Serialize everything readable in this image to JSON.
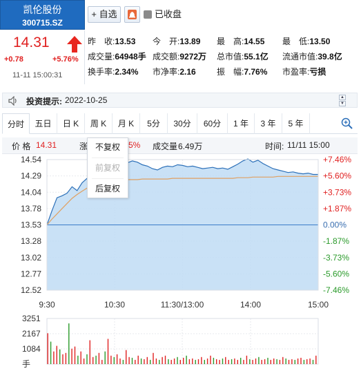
{
  "header": {
    "stock_name": "凯伦股份",
    "stock_code": "300715.SZ",
    "add_watch_label": "+ 自选",
    "market_status": "已收盘"
  },
  "quote": {
    "price": "14.31",
    "change_abs": "+0.78",
    "change_pct": "+5.76%",
    "time": "11-11 15:00:31"
  },
  "stats": [
    {
      "label": "昨　收:",
      "value": "13.53"
    },
    {
      "label": "今　开:",
      "value": "13.89"
    },
    {
      "label": "最　高:",
      "value": "14.55"
    },
    {
      "label": "最　低:",
      "value": "13.50"
    },
    {
      "label": "成交量:",
      "value": "64948手"
    },
    {
      "label": "成交额:",
      "value": "9272万"
    },
    {
      "label": "总市值:",
      "value": "55.1亿"
    },
    {
      "label": "流通市值:",
      "value": "39.8亿"
    },
    {
      "label": "换手率:",
      "value": "2.34%"
    },
    {
      "label": "市净率:",
      "value": "2.16"
    },
    {
      "label": "振　幅:",
      "value": "7.76%"
    },
    {
      "label": "市盈率:",
      "value": "亏损"
    }
  ],
  "notice": {
    "label": "投资提示:",
    "date": "2022-10-25"
  },
  "tabs": [
    "分时",
    "五日",
    "日 K",
    "周 K",
    "月 K",
    "5分",
    "30分",
    "60分",
    "1 年",
    "3 年",
    "5 年"
  ],
  "info_row": {
    "price_label": "价 格",
    "price_value": "14.31",
    "partial_label": "涨",
    "partial_pct": "5%",
    "volume_label": "成交量",
    "volume_value": "6.49万",
    "time_label": "时间:",
    "time_value": "11/11 15:00"
  },
  "adjust_menu": {
    "items": [
      "不复权",
      "前复权",
      "后复权"
    ],
    "disabled_index": 1
  },
  "colors": {
    "up": "#e02020",
    "down": "#2a9a2a",
    "header_bg": "#1f6bbf"
  },
  "chart_data": [
    {
      "type": "area",
      "title": "",
      "x_ticks": [
        "9:30",
        "10:30",
        "11:30/13:00",
        "14:00",
        "15:00"
      ],
      "y_ticks_left": [
        "14.54",
        "14.29",
        "14.04",
        "13.78",
        "13.53",
        "13.28",
        "13.02",
        "12.77",
        "12.52"
      ],
      "y_ticks_right": [
        "+7.46%",
        "+5.60%",
        "+3.73%",
        "+1.87%",
        "0.00%",
        "-1.87%",
        "-3.73%",
        "-5.60%",
        "-7.46%"
      ],
      "ylim": [
        12.52,
        14.54
      ],
      "baseline": 13.53,
      "series": [
        {
          "values": [
            13.53,
            13.75,
            13.95,
            13.98,
            14.02,
            14.12,
            14.06,
            14.18,
            14.25,
            14.32,
            14.38,
            14.4,
            14.44,
            14.48,
            14.5,
            14.47,
            14.49,
            14.52,
            14.5,
            14.46,
            14.44,
            14.4,
            14.38,
            14.42,
            14.44,
            14.43,
            14.46,
            14.45,
            14.43,
            14.44,
            14.42,
            14.4,
            14.41,
            14.42,
            14.4,
            14.41,
            14.39,
            14.43,
            14.47,
            14.52,
            14.55,
            14.5,
            14.53,
            14.48,
            14.44,
            14.4,
            14.38,
            14.36,
            14.34,
            14.35,
            14.33,
            14.32,
            14.33,
            14.31,
            14.31
          ]
        },
        {
          "values": [
            13.53,
            13.62,
            13.7,
            13.78,
            13.86,
            13.94,
            14.0,
            14.05,
            14.1,
            14.14,
            14.17,
            14.19,
            14.2,
            14.21,
            14.22,
            14.22,
            14.23,
            14.23,
            14.23,
            14.24,
            14.24,
            14.24,
            14.24,
            14.24,
            14.24,
            14.25,
            14.25,
            14.25,
            14.25,
            14.25,
            14.25,
            14.25,
            14.25,
            14.25,
            14.25,
            14.25,
            14.25,
            14.25,
            14.26,
            14.26,
            14.26,
            14.27,
            14.27,
            14.27,
            14.27,
            14.27,
            14.28,
            14.28,
            14.28,
            14.28,
            14.28,
            14.28,
            14.28,
            14.28,
            14.28
          ]
        }
      ]
    },
    {
      "type": "bar",
      "title": "",
      "y_ticks": [
        "3251",
        "2167",
        "1084",
        "手"
      ],
      "ylim": [
        0,
        3251
      ],
      "values": [
        2200,
        1600,
        900,
        1300,
        1050,
        700,
        800,
        2900,
        1100,
        1250,
        600,
        900,
        400,
        700,
        1700,
        500,
        600,
        800,
        300,
        900,
        1800,
        600,
        500,
        700,
        400,
        300,
        1000,
        500,
        450,
        300,
        600,
        400,
        350,
        500,
        300,
        800,
        400,
        300,
        500,
        600,
        350,
        300,
        400,
        500,
        300,
        450,
        600,
        350,
        400,
        300,
        350,
        500,
        300,
        400,
        600,
        450,
        350,
        300,
        400,
        500,
        300,
        350,
        400,
        300,
        450,
        300,
        600,
        350,
        300,
        400,
        500,
        300,
        350,
        450,
        300,
        400,
        350,
        300,
        500,
        400,
        300,
        350,
        300,
        400,
        450,
        300,
        350,
        400,
        300,
        600
      ]
    }
  ]
}
